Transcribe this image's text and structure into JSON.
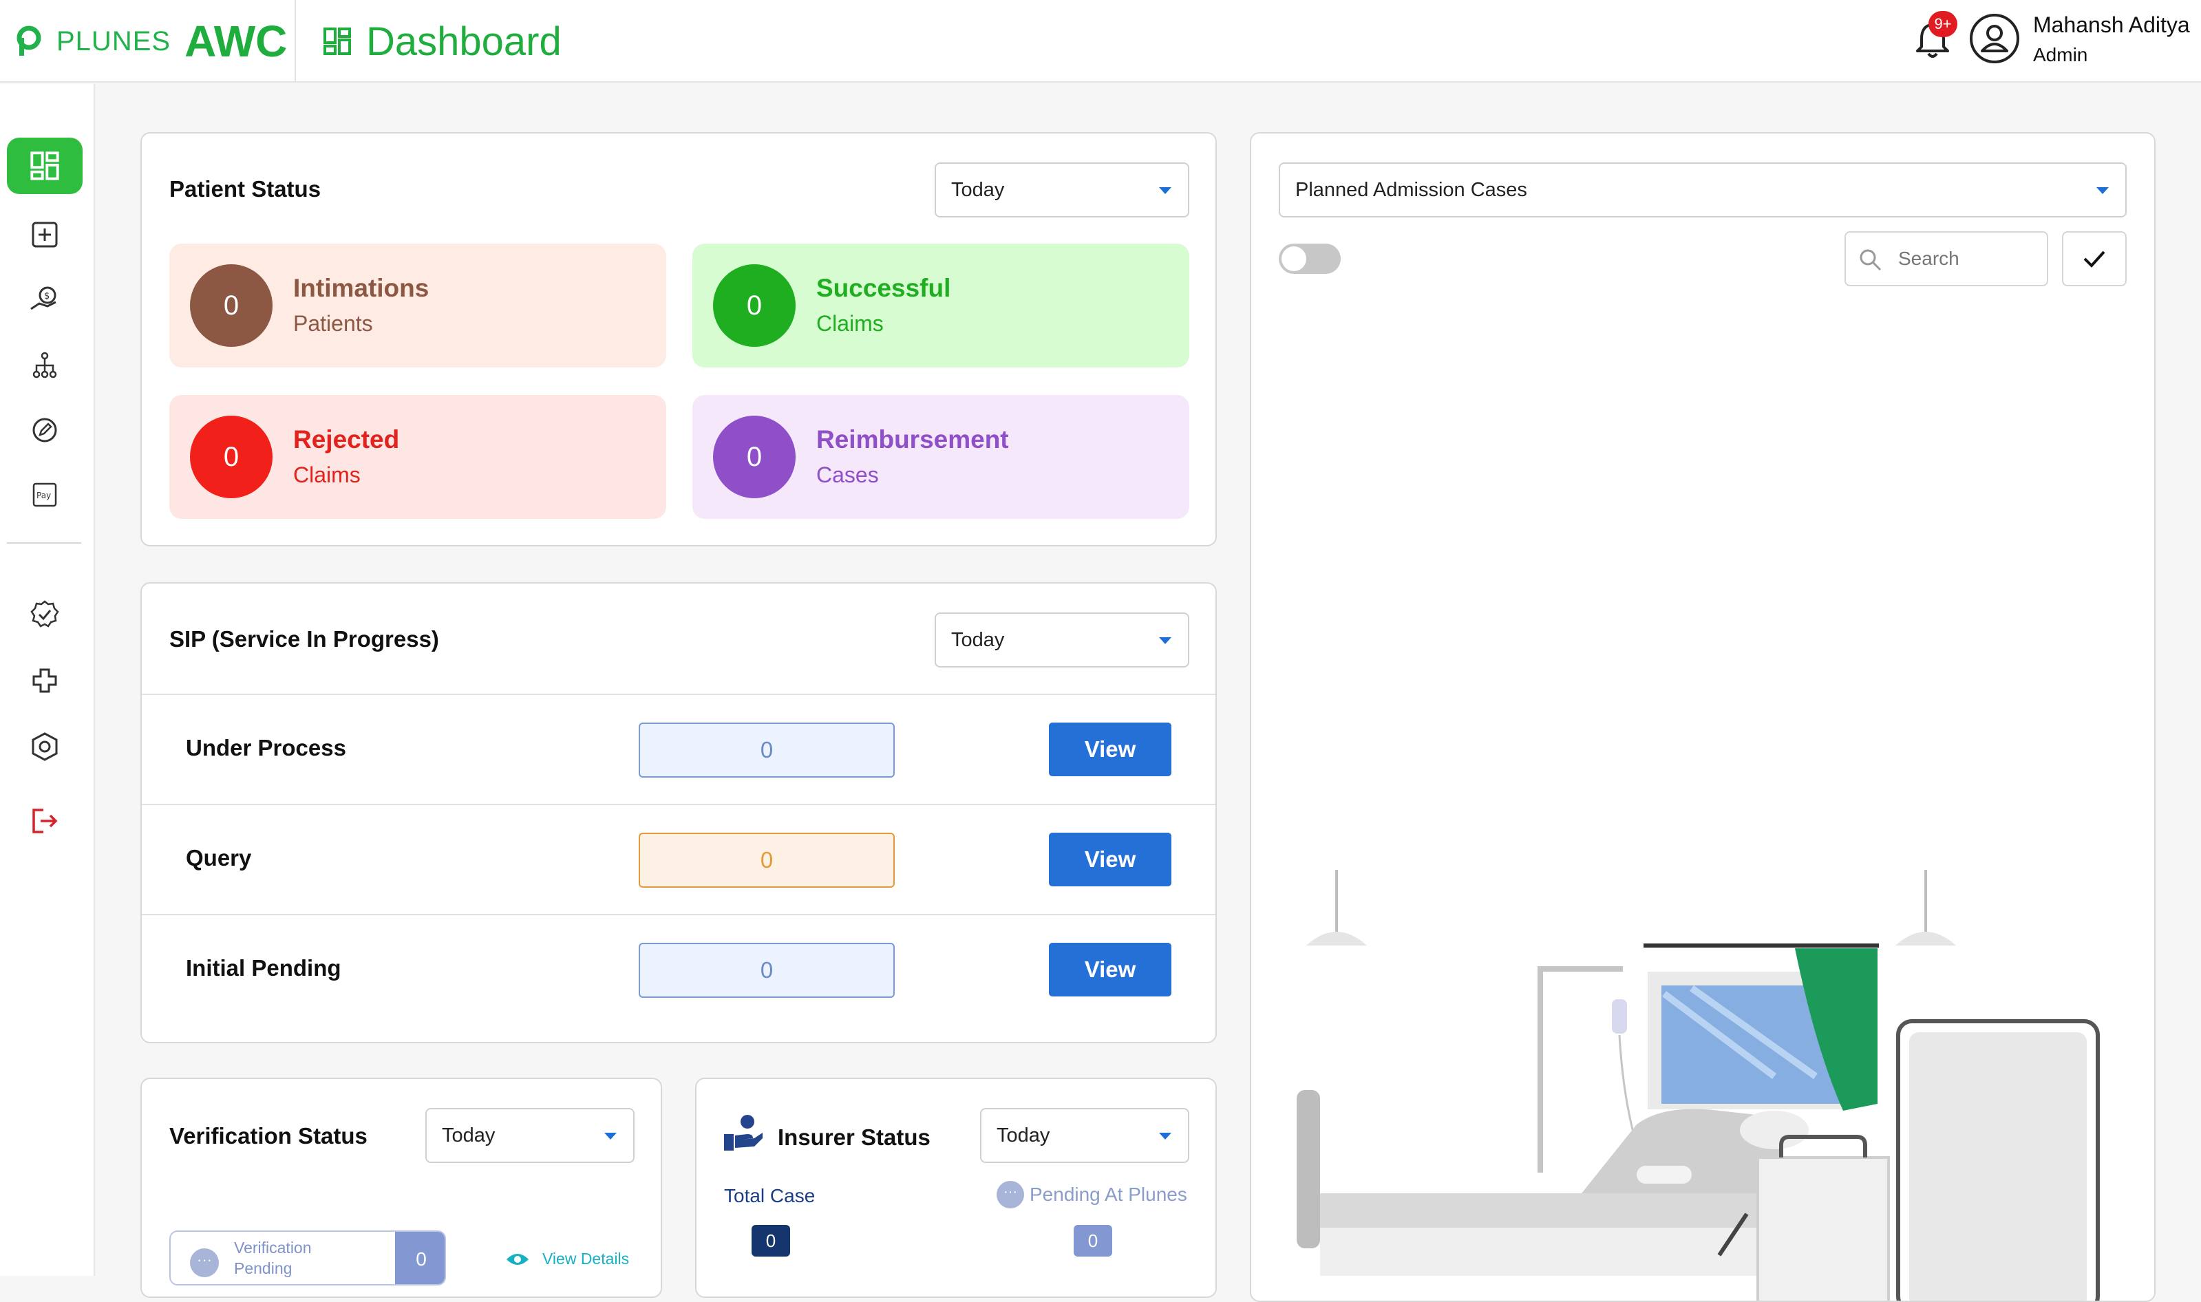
{
  "header": {
    "brand_plunes": "PLUNES",
    "brand_awc": "AWC",
    "title": "Dashboard",
    "notification_badge": "9+",
    "user_name": "Mahansh Aditya",
    "user_role": "Admin"
  },
  "sidebar": {
    "items": [
      {
        "name": "dashboard-icon",
        "active": true
      },
      {
        "name": "add-case-icon",
        "active": false
      },
      {
        "name": "claims-money-icon",
        "active": false
      },
      {
        "name": "hierarchy-icon",
        "active": false
      },
      {
        "name": "edit-circle-icon",
        "active": false
      },
      {
        "name": "pay-icon",
        "active": false
      },
      {
        "name": "verified-badge-icon",
        "active": false
      },
      {
        "name": "medical-cross-icon",
        "active": false
      },
      {
        "name": "settings-hexagon-icon",
        "active": false
      },
      {
        "name": "logout-icon",
        "active": false
      }
    ]
  },
  "patient_status": {
    "title": "Patient Status",
    "filter": "Today",
    "tiles": [
      {
        "value": "0",
        "title": "Intimations",
        "subtitle": "Patients",
        "bg": "#fdebe4",
        "circle": "#8c5843",
        "color": "#8c5843"
      },
      {
        "value": "0",
        "title": "Successful",
        "subtitle": "Claims",
        "bg": "#d7fcd2",
        "circle": "#1fae1f",
        "color": "#1fae1f"
      },
      {
        "value": "0",
        "title": "Rejected",
        "subtitle": "Claims",
        "bg": "#fde6e3",
        "circle": "#f2201a",
        "color": "#e2221c"
      },
      {
        "value": "0",
        "title": "Reimbursement",
        "subtitle": "Cases",
        "bg": "#f6e8fb",
        "circle": "#8e4fc8",
        "color": "#8e4fc8"
      }
    ]
  },
  "sip": {
    "title": "SIP (Service In Progress)",
    "filter": "Today",
    "rows": [
      {
        "label": "Under Process",
        "value": "0",
        "button": "View",
        "bg": "#ecf2fe",
        "border": "#7c9ad0",
        "text": "#6a8bc4"
      },
      {
        "label": "Query",
        "value": "0",
        "button": "View",
        "bg": "#fdf1e5",
        "border": "#e39a3a",
        "text": "#e39a3a"
      },
      {
        "label": "Initial Pending",
        "value": "0",
        "button": "View",
        "bg": "#ecf2fe",
        "border": "#7c9ad0",
        "text": "#6a8bc4"
      }
    ]
  },
  "verification": {
    "title": "Verification Status",
    "filter": "Today",
    "chip_label": "Verification Pending",
    "chip_value": "0",
    "view_details": "View Details"
  },
  "insurer": {
    "title": "Insurer Status",
    "filter": "Today",
    "total_label": "Total Case",
    "total_value": "0",
    "pending_label": "Pending At Plunes",
    "pending_value": "0"
  },
  "planned": {
    "select_value": "Planned Admission Cases",
    "search_placeholder": "Search",
    "toggle_on": false
  },
  "colors": {
    "brand_green": "#1fae3e",
    "primary_blue": "#2470d6",
    "danger": "#e11b22"
  }
}
